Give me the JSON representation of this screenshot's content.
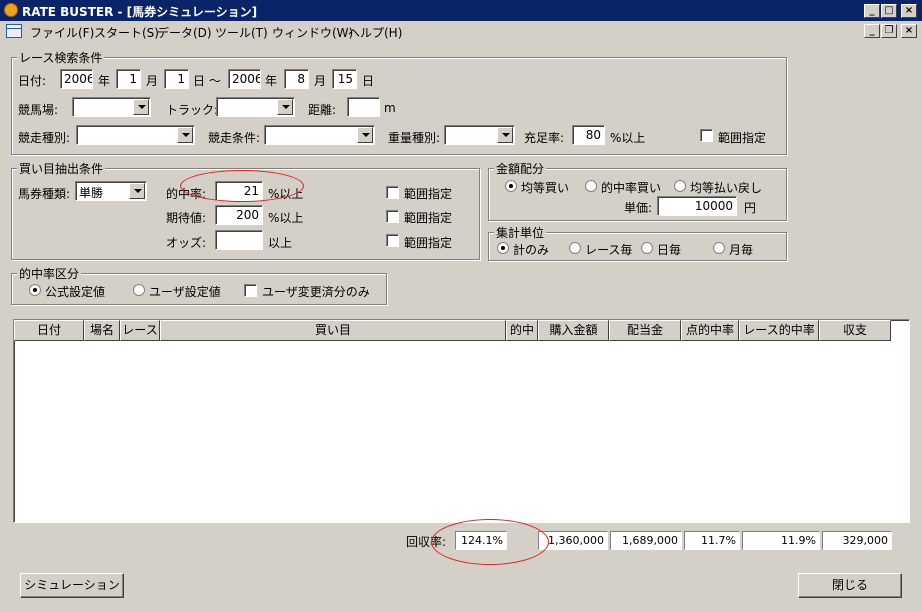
{
  "window": {
    "title": "RATE BUSTER - [馬券シミュレーション]"
  },
  "menu": [
    "ファイル(F)",
    "スタート(S)",
    "データ(D)",
    "ツール(T)",
    "ウィンドウ(W)",
    "ヘルプ(H)"
  ],
  "search": {
    "group_label": "レース検索条件",
    "date_label": "日付:",
    "from_year": "2006",
    "from_month": "1",
    "from_day": "1",
    "to_year": "2006",
    "to_month": "8",
    "to_day": "15",
    "year_unit": "年",
    "month_unit": "月",
    "day_unit": "日",
    "tilde": "～",
    "racecourse_label": "競馬場:",
    "racecourse_value": "",
    "track_label": "トラック:",
    "track_value": "",
    "distance_label": "距離:",
    "distance_value": "",
    "distance_unit": "m",
    "race_type_label": "競走種別:",
    "race_type_value": "",
    "race_cond_label": "競走条件:",
    "race_cond_value": "",
    "weight_label": "重量種別:",
    "weight_value": "",
    "fill_label": "充足率:",
    "fill_value": "80",
    "fill_unit": "%以上",
    "range_label": "範囲指定"
  },
  "bet": {
    "group_label": "買い目抽出条件",
    "ticket_label": "馬券種類:",
    "ticket_value": "単勝",
    "hit_label": "的中率:",
    "hit_value": "21",
    "hit_unit": "%以上",
    "expect_label": "期待値:",
    "expect_value": "200",
    "expect_unit": "%以上",
    "odds_label": "オッズ:",
    "odds_value": "",
    "odds_unit": "以上",
    "range_label": "範囲指定"
  },
  "money": {
    "group_label": "金額配分",
    "opt1": "均等買い",
    "opt2": "的中率買い",
    "opt3": "均等払い戻し",
    "unit_label": "単価:",
    "unit_value": "10000",
    "unit_suffix": "円"
  },
  "aggregate": {
    "group_label": "集計単位",
    "opt1": "計のみ",
    "opt2": "レース毎",
    "opt3": "日毎",
    "opt4": "月毎"
  },
  "hitclass": {
    "group_label": "的中率区分",
    "opt1": "公式設定値",
    "opt2": "ユーザ設定値",
    "opt3": "ユーザ変更済分のみ"
  },
  "table": {
    "headers": [
      "日付",
      "場名",
      "レース",
      "買い目",
      "的中",
      "購入金額",
      "配当金",
      "点的中率",
      "レース的中率",
      "収支"
    ]
  },
  "summary": {
    "recovery_label": "回収率:",
    "recovery_value": "124.1%",
    "purchase": "1,360,000",
    "payout": "1,689,000",
    "point_hit": "11.7%",
    "race_hit": "11.9%",
    "balance": "329,000"
  },
  "buttons": {
    "simulate": "シミュレーション",
    "close": "閉じる"
  },
  "colors": {
    "titlebar": "#0a246a",
    "face": "#d4d0c8",
    "annotation": "#e02020"
  }
}
